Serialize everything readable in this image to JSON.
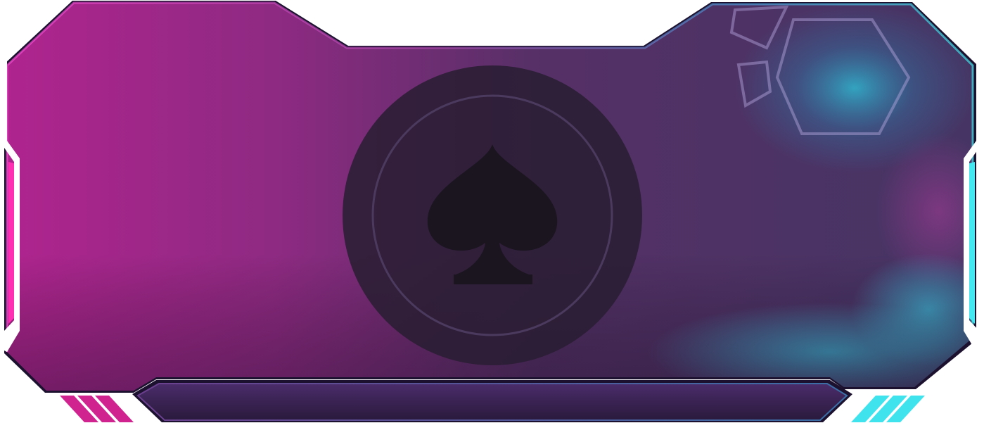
{
  "card": {
    "suit_icon": "spade-icon",
    "caption_text": ""
  },
  "colors": {
    "magenta": "#a3228f",
    "purple": "#4a3060",
    "cyan": "#35e6ee",
    "coin": "#2a1e33",
    "spade": "#1b1520"
  }
}
